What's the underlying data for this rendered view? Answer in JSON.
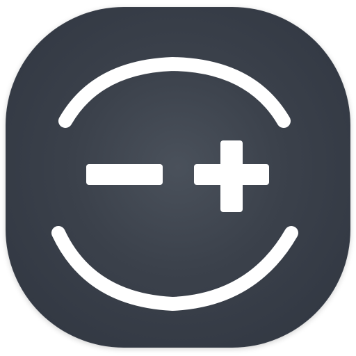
{
  "app_icon": {
    "icon_name": "zoom-in-out-icon",
    "background_color": "#3a404a",
    "foreground_color": "#ffffff",
    "minus_icon": "minus-icon",
    "plus_icon": "plus-icon",
    "top_arc": "top-arc",
    "bottom_arc": "bottom-arc"
  }
}
